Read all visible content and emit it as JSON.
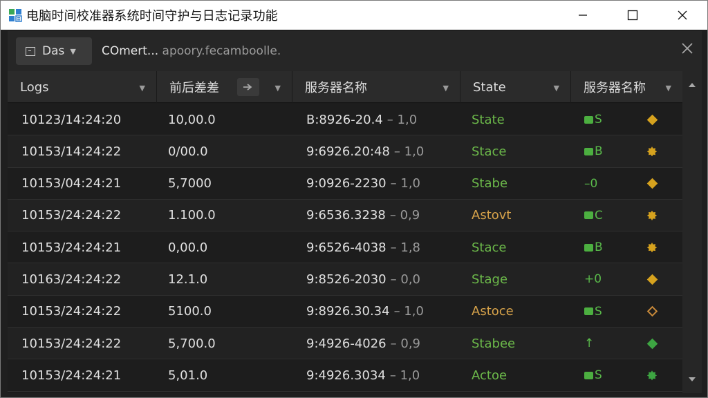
{
  "window": {
    "title": "电脑时间校准器系统时间守护与日志记录功能",
    "controls": {
      "minimize": "—",
      "maximize": "☐",
      "close": "✕"
    }
  },
  "toolbar": {
    "filter_label": "Das",
    "search_main": "COmert...",
    "search_rest": "apoory.fecamboolle.",
    "close_glyph": "✕"
  },
  "table": {
    "columns": [
      "Logs",
      "前后差差",
      "服务器名称",
      "State",
      "服务器名称"
    ],
    "rows": [
      {
        "time": "10123/14:24:20",
        "offset": "10,00.0",
        "server": "B:8926-20.4",
        "delta": "– 1,0",
        "state": "State",
        "state_color": "#6cb94a",
        "code": "S",
        "code_style": "sq",
        "mark": "diamond"
      },
      {
        "time": "10153/14:24:22",
        "offset": "0/00.0",
        "server": "9:6926.20:48",
        "delta": "– 1,0",
        "state": "Stace",
        "state_color": "#6cb94a",
        "code": "B",
        "code_style": "sq",
        "mark": "gear"
      },
      {
        "time": "10153/04:24:21",
        "offset": "5,7000",
        "server": "9:0926-2230",
        "delta": "– 1,0",
        "state": "Stabe",
        "state_color": "#6cb94a",
        "code": "–0",
        "code_style": "none",
        "mark": "diamond"
      },
      {
        "time": "10153/24:24:22",
        "offset": "1.100.0",
        "server": "9:6536.3238",
        "delta": "– 0,9",
        "state": "Astovt",
        "state_color": "#d6a24a",
        "code": "C",
        "code_style": "sq",
        "mark": "gear"
      },
      {
        "time": "10153/24:24:21",
        "offset": "0,00.0",
        "server": "9:6526-4038",
        "delta": "– 1,8",
        "state": "Stace",
        "state_color": "#6cb94a",
        "code": "B",
        "code_style": "sq",
        "mark": "gear"
      },
      {
        "time": "10163/24:24:22",
        "offset": "12.1.0",
        "server": "9:8526-2030",
        "delta": "– 0,0",
        "state": "Stage",
        "state_color": "#6cb94a",
        "code": "+0",
        "code_style": "none",
        "mark": "diamond"
      },
      {
        "time": "10153/24:24:22",
        "offset": "5100.0",
        "server": "9:8926.30.34",
        "delta": "– 1,0",
        "state": "Astoce",
        "state_color": "#d6a24a",
        "code": "S",
        "code_style": "sq",
        "mark": "ring"
      },
      {
        "time": "10153/24:24:22",
        "offset": "5,700.0",
        "server": "9:4926-4026",
        "delta": "– 0,9",
        "state": "Stabee",
        "state_color": "#6cb94a",
        "code": "↑",
        "code_style": "none",
        "mark": "diamond-g"
      },
      {
        "time": "10153/24:24:21",
        "offset": "5,01.0",
        "server": "9:4926.3034",
        "delta": "– 1,0",
        "state": "Actoe",
        "state_color": "#6cb94a",
        "code": "S",
        "code_style": "sq",
        "mark": "gear-g"
      }
    ]
  },
  "colors": {
    "window_bg": "#1f1f1f",
    "accent_green": "#6cb94a",
    "accent_amber": "#d6a24a"
  }
}
